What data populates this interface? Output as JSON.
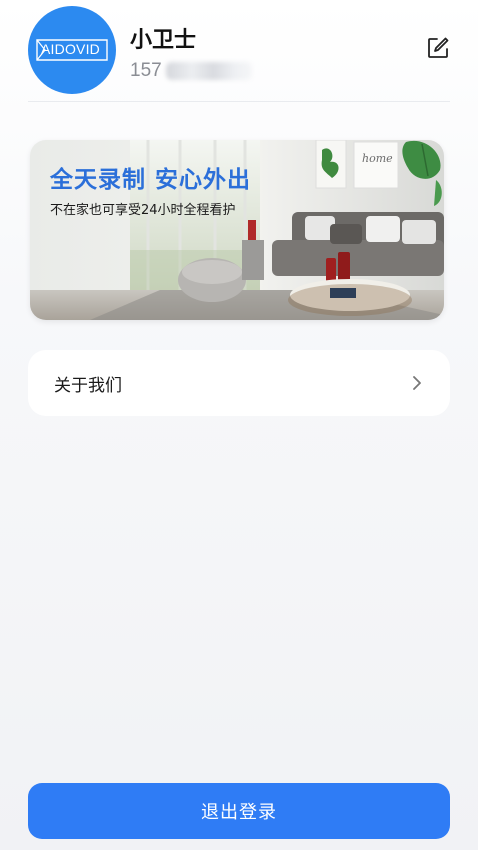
{
  "profile": {
    "avatar_logo_text": "AIDOVID",
    "name": "小卫士",
    "phone_visible": "157",
    "edit_icon": "edit-icon"
  },
  "banner": {
    "title": "全天录制 安心外出",
    "subtitle": "不在家也可享受24小时全程看护",
    "wall_art_text": "home"
  },
  "menu": {
    "about_label": "关于我们",
    "chevron_icon": "chevron-right-icon"
  },
  "logout": {
    "label": "退出登录"
  },
  "colors": {
    "accent": "#2f7cf5",
    "banner_title": "#2b6fd9",
    "avatar_bg": "#2c8af0"
  }
}
